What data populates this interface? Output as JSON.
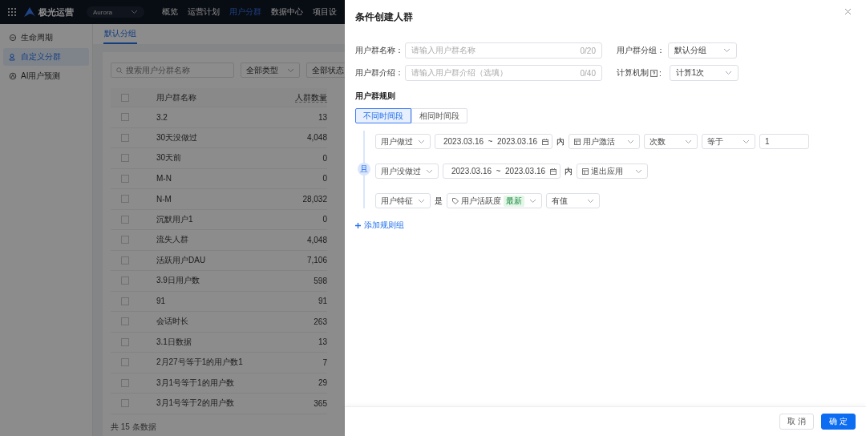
{
  "topbar": {
    "brand": "极光运营",
    "project": "Aurora",
    "nav": [
      {
        "label": "概览",
        "selected": false
      },
      {
        "label": "运营计划",
        "selected": false
      },
      {
        "label": "用户分群",
        "selected": true
      },
      {
        "label": "数据中心",
        "selected": false
      },
      {
        "label": "项目设",
        "selected": false
      }
    ]
  },
  "sidebar": {
    "items": [
      {
        "label": "生命周期",
        "selected": false
      },
      {
        "label": "自定义分群",
        "selected": true
      },
      {
        "label": "AI用户预测",
        "selected": false
      }
    ]
  },
  "content": {
    "tabs": [
      {
        "label": "默认分组",
        "selected": true
      }
    ],
    "search": {
      "placeholder": "搜索用户分群名称"
    },
    "filters": [
      "全部类型",
      "全部状态"
    ],
    "table": {
      "columns": [
        "用户群名称",
        "人群数量"
      ],
      "all_checked": false,
      "rows": [
        {
          "name": "3.2",
          "count": "13",
          "checked": false
        },
        {
          "name": "30天没做过",
          "count": "4,048",
          "checked": false
        },
        {
          "name": "30天前",
          "count": "0",
          "checked": false
        },
        {
          "name": "M-N",
          "count": "0",
          "checked": false
        },
        {
          "name": "N-M",
          "count": "28,032",
          "checked": false
        },
        {
          "name": "沉默用户1",
          "count": "0",
          "checked": false
        },
        {
          "name": "流失人群",
          "count": "4,048",
          "checked": false
        },
        {
          "name": "活跃用户DAU",
          "count": "7,106",
          "checked": false
        },
        {
          "name": "3.9日用户数",
          "count": "598",
          "checked": false
        },
        {
          "name": "91",
          "count": "91",
          "checked": false
        },
        {
          "name": "会话时长",
          "count": "263",
          "checked": false
        },
        {
          "name": "3.1日数据",
          "count": "13",
          "checked": false
        },
        {
          "name": "2月27号等于1的用户数1",
          "count": "7",
          "checked": false
        },
        {
          "name": "3月1号等于1的用户数",
          "count": "29",
          "checked": false
        },
        {
          "name": "3月1号等于2的用户数",
          "count": "365",
          "checked": false
        }
      ]
    },
    "footer": "共 15 条数据"
  },
  "drawer": {
    "title": "条件创建人群",
    "fields": [
      {
        "label": "用户群名称：",
        "placeholder": "请输入用户群名称",
        "counter": "0/20"
      },
      {
        "label": "用户群介绍：",
        "placeholder": "请输入用户群介绍（选填）",
        "counter": "0/40"
      }
    ],
    "selects": [
      {
        "label": "用户群分组：",
        "value": "默认分组",
        "help": false
      },
      {
        "label": "计算机制",
        "value": "计算1次",
        "help": true,
        "colon": ":"
      }
    ],
    "rules_title": "用户群规则",
    "segments": [
      {
        "label": "不同时间段",
        "selected": true
      },
      {
        "label": "相同时间段",
        "selected": false
      }
    ],
    "connector": "且",
    "conditions": [
      [
        {
          "kind": "select",
          "text": "用户做过"
        },
        {
          "kind": "date",
          "text": "2023.03.16  ~  2023.03.16"
        },
        {
          "kind": "word",
          "text": "内"
        },
        {
          "kind": "event",
          "text": "用户激活"
        },
        {
          "kind": "select",
          "text": "次数"
        },
        {
          "kind": "select",
          "text": "等于"
        },
        {
          "kind": "input",
          "text": "1"
        }
      ],
      [
        {
          "kind": "select",
          "text": "用户没做过"
        },
        {
          "kind": "date",
          "text": "2023.03.16  ~  2023.03.16"
        },
        {
          "kind": "word",
          "text": "内"
        },
        {
          "kind": "event",
          "text": "退出应用"
        }
      ],
      [
        {
          "kind": "select",
          "text": "用户特征"
        },
        {
          "kind": "word",
          "text": "是"
        },
        {
          "kind": "tag",
          "text": "用户活跃度",
          "badge": "最新"
        },
        {
          "kind": "select",
          "text": "有值"
        }
      ]
    ],
    "add_rule": "添加规则组",
    "buttons": [
      {
        "label": "取 消",
        "kind": "default"
      },
      {
        "label": "确 定",
        "kind": "primary"
      }
    ]
  }
}
